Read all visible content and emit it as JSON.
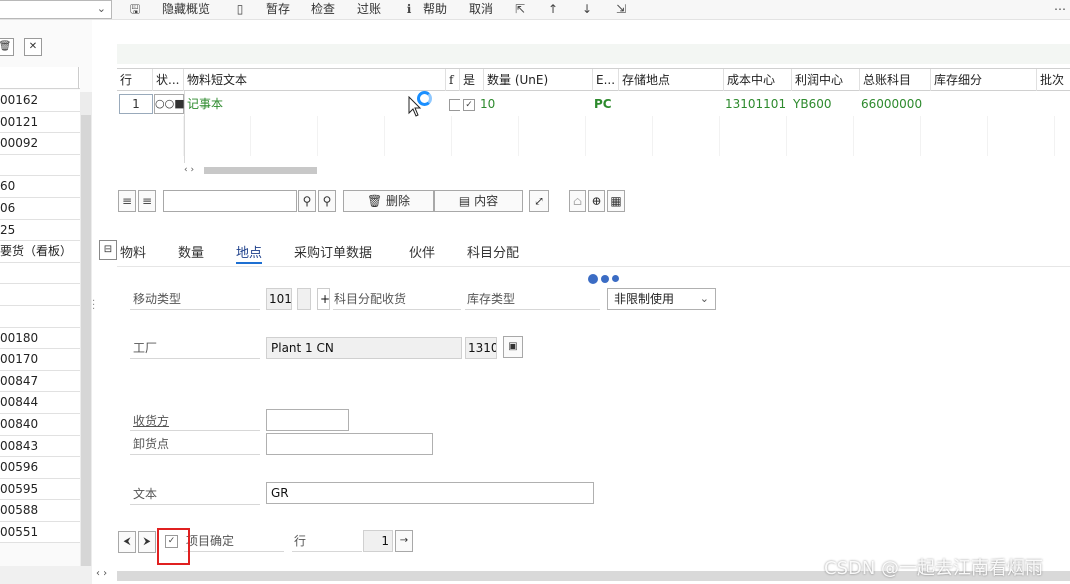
{
  "toolbar": {
    "hide_overview": "隐藏概览",
    "save_draft": "暂存",
    "check": "检查",
    "post": "过账",
    "help": "帮助",
    "cancel": "取消"
  },
  "left_list": {
    "rows": [
      "00162",
      "00121",
      "00092",
      "",
      "60",
      "06",
      "25",
      "要货（看板）",
      "",
      "",
      "",
      "00180",
      "00170",
      "00847",
      "00844",
      "00840",
      "00843",
      "00596",
      "00595",
      "00588",
      "00551"
    ]
  },
  "grid": {
    "headers": {
      "line": "行",
      "status": "状...",
      "short_text": "物料短文本",
      "flag": "f",
      "yes": "是",
      "qty": "数量 (UnE)",
      "unit": "E...",
      "storage_loc": "存储地点",
      "cost_center": "成本中心",
      "profit_center": "利润中心",
      "gl_account": "总账科目",
      "stock_detail": "库存细分",
      "batch": "批次"
    },
    "row": {
      "line": "1",
      "status": "○○■",
      "short_text": "记事本",
      "qty": "10",
      "unit": "PC",
      "cost_center": "13101101",
      "profit_center": "YB600",
      "gl_account": "66000000"
    },
    "scroll_arrows": "‹ ›"
  },
  "grid_toolbar": {
    "delete_label": "删除",
    "content_label": "内容"
  },
  "tabs": [
    "物料",
    "数量",
    "地点",
    "采购订单数据",
    "伙伴",
    "科目分配"
  ],
  "active_tab": "地点",
  "form": {
    "movement_type_label": "移动类型",
    "movement_type_value": "101",
    "plus": "+",
    "account_assignment_label": "科目分配收货",
    "stock_type_label": "库存类型",
    "stock_type_value": "非限制使用",
    "plant_label": "工厂",
    "plant_name": "Plant 1 CN",
    "plant_code": "1310",
    "recipient_label": "收货方",
    "unloading_point_label": "卸货点",
    "text_label": "文本",
    "text_value": "GR",
    "item_ok_label": "项目确定",
    "line_label": "行",
    "line_value": "1"
  },
  "watermark": "CSDN @一起去江南看烟雨",
  "colors": {
    "accent": "#1d6fd2",
    "green_values": "#2d8a2d",
    "highlight_box": "#e02020"
  }
}
